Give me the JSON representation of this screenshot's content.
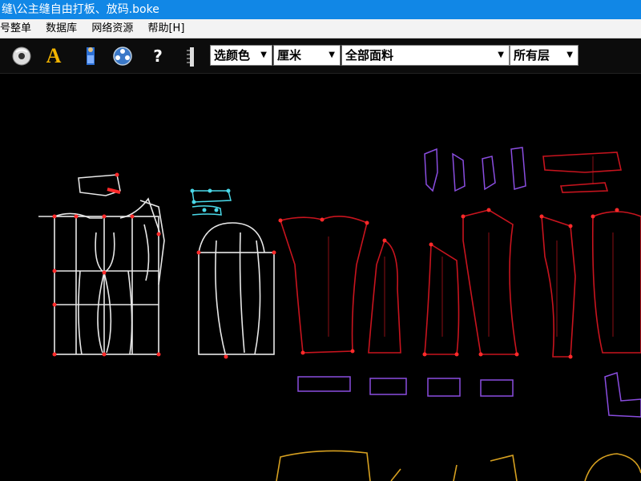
{
  "window": {
    "title": "缝\\公主缝自由打板、放码.boke"
  },
  "menu": {
    "items": [
      "号整单",
      "数据库",
      "网络资源",
      "帮助[H]"
    ]
  },
  "toolbar": {
    "tools": [
      "cd-icon",
      "text-a-icon",
      "figure-icon",
      "film-reel-icon",
      "help-icon",
      "ruler-icon"
    ],
    "help_glyph": "?",
    "text_glyph": "A",
    "color_select": {
      "value": "选颜色"
    },
    "unit_select": {
      "value": "厘米"
    },
    "fabric_select": {
      "value": "全部面料"
    },
    "layer_select": {
      "value": "所有层"
    }
  },
  "colors": {
    "titlebar": "#1187e6",
    "pattern_white": "#e8e8e8",
    "pattern_red": "#c8141e",
    "pattern_purple": "#8a4de0",
    "pattern_yellow": "#d6a020",
    "point_red": "#ff2a2a",
    "point_cyan": "#4ad8e8"
  }
}
